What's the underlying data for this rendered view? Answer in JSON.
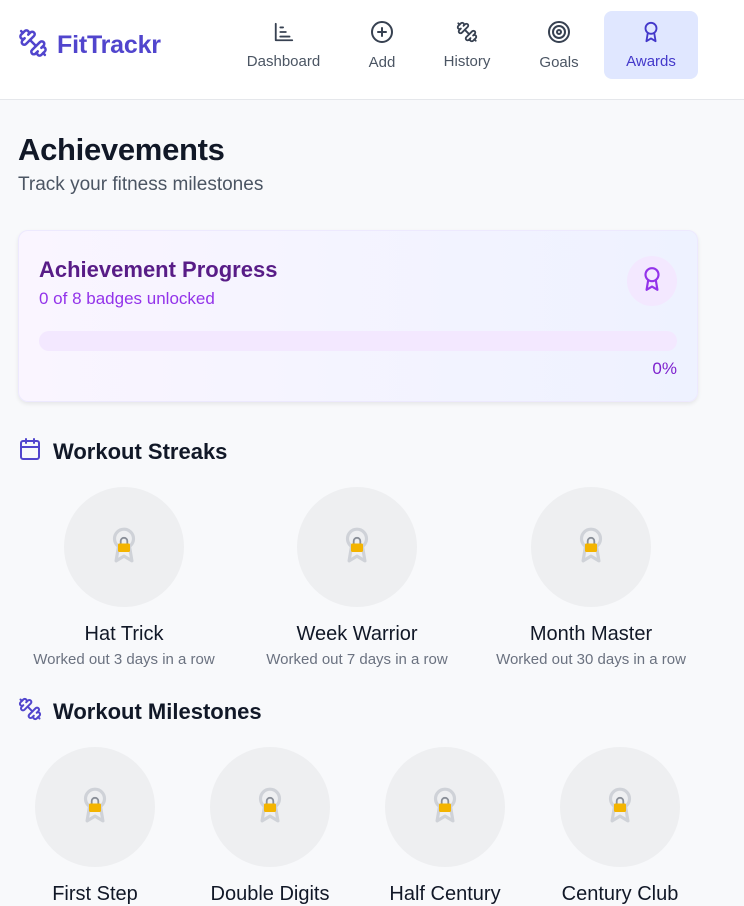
{
  "app": {
    "brand": "FitTrackr",
    "brand_color": "#5145cd"
  },
  "nav": [
    {
      "label": "Dashboard",
      "icon": "bar-chart-icon",
      "active": false
    },
    {
      "label": "Add",
      "icon": "plus-circle-icon",
      "active": false
    },
    {
      "label": "History",
      "icon": "dumbbell-icon",
      "active": false
    },
    {
      "label": "Goals",
      "icon": "target-icon",
      "active": false
    },
    {
      "label": "Awards",
      "icon": "award-icon",
      "active": true
    }
  ],
  "page": {
    "title": "Achievements",
    "subtitle": "Track your fitness milestones"
  },
  "progress": {
    "title": "Achievement Progress",
    "subtitle": "0 of 8 badges unlocked",
    "unlocked": 0,
    "total": 8,
    "percent_label": "0%",
    "percent_value": 0,
    "accent": "#7e22ce"
  },
  "sections": [
    {
      "title": "Workout Streaks",
      "icon": "calendar-icon",
      "badges": [
        {
          "name": "Hat Trick",
          "desc": "Worked out 3 days in a row",
          "locked": true
        },
        {
          "name": "Week Warrior",
          "desc": "Worked out 7 days in a row",
          "locked": true
        },
        {
          "name": "Month Master",
          "desc": "Worked out 30 days in a row",
          "locked": true
        }
      ]
    },
    {
      "title": "Workout Milestones",
      "icon": "dumbbell-icon",
      "badges": [
        {
          "name": "First Step",
          "locked": true
        },
        {
          "name": "Double Digits",
          "locked": true
        },
        {
          "name": "Half Century",
          "locked": true
        },
        {
          "name": "Century Club",
          "locked": true
        }
      ]
    }
  ]
}
